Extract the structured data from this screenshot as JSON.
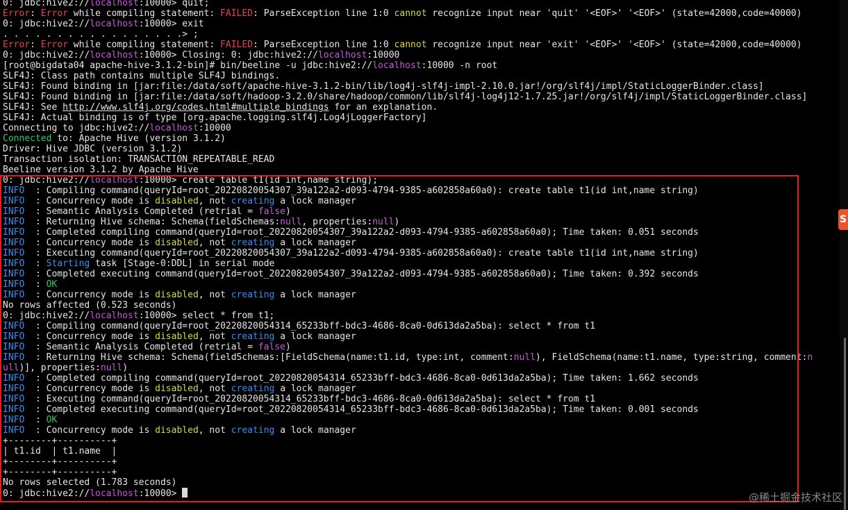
{
  "terminal": {
    "lines": [
      [
        {
          "t": "0: jdbc:hive2://"
        },
        {
          "t": "localhost",
          "c": "magenta"
        },
        {
          "t": ":10000> quit;"
        }
      ],
      [
        {
          "t": "Error",
          "c": "red"
        },
        {
          "t": ": "
        },
        {
          "t": "Error",
          "c": "red"
        },
        {
          "t": " while compiling statement: "
        },
        {
          "t": "FAILED",
          "c": "red"
        },
        {
          "t": ": ParseException line 1:0 "
        },
        {
          "t": "cannot",
          "c": "yellow"
        },
        {
          "t": " recognize input near 'quit' '<EOF>' '<EOF>' (state=42000,code=40000)"
        }
      ],
      [
        {
          "t": "0: jdbc:hive2://"
        },
        {
          "t": "localhost",
          "c": "magenta"
        },
        {
          "t": ":10000> exit"
        }
      ],
      [
        {
          "t": ". . . . . . . . . . . . . . . . .> ;"
        }
      ],
      [
        {
          "t": "Error",
          "c": "red"
        },
        {
          "t": ": "
        },
        {
          "t": "Error",
          "c": "red"
        },
        {
          "t": " while compiling statement: "
        },
        {
          "t": "FAILED",
          "c": "red"
        },
        {
          "t": ": ParseException line 1:0 "
        },
        {
          "t": "cannot",
          "c": "yellow"
        },
        {
          "t": " recognize input near 'exit' '<EOF>' '<EOF>' (state=42000,code=40000)"
        }
      ],
      [
        {
          "t": "0: jdbc:hive2://"
        },
        {
          "t": "localhost",
          "c": "magenta"
        },
        {
          "t": ":10000> Closing: 0: jdbc:hive2://"
        },
        {
          "t": "localhost",
          "c": "magenta"
        },
        {
          "t": ":10000"
        }
      ],
      [
        {
          "t": "[root@bigdata04 apache-hive-3.1.2-bin]# bin/beeline -u jdbc:hive2://"
        },
        {
          "t": "localhost",
          "c": "magenta"
        },
        {
          "t": ":10000 -n root"
        }
      ],
      [
        {
          "t": "SLF4J: Class path contains multiple SLF4J bindings."
        }
      ],
      [
        {
          "t": "SLF4J: Found binding in [jar:file:/data/soft/apache-hive-3.1.2-bin/lib/log4j-slf4j-impl-2.10.0.jar!/org/slf4j/impl/StaticLoggerBinder.class]"
        }
      ],
      [
        {
          "t": "SLF4J: Found binding in [jar:file:/data/soft/hadoop-3.2.0/share/hadoop/common/lib/slf4j-log4j12-1.7.25.jar!/org/slf4j/impl/StaticLoggerBinder.class]"
        }
      ],
      [
        {
          "t": "SLF4J: See "
        },
        {
          "t": "http://www.slf4j.org/codes.html#multiple_bindings",
          "c": "link"
        },
        {
          "t": " for an explanation."
        }
      ],
      [
        {
          "t": "SLF4J: Actual binding is of type [org.apache.logging.slf4j.Log4jLoggerFactory]"
        }
      ],
      [
        {
          "t": "Connecting to jdbc:hive2://"
        },
        {
          "t": "localhost",
          "c": "magenta"
        },
        {
          "t": ":10000"
        }
      ],
      [
        {
          "t": "Connected",
          "c": "green"
        },
        {
          "t": " to: Apache Hive (version 3.1.2)"
        }
      ],
      [
        {
          "t": "Driver: Hive JDBC (version 3.1.2)"
        }
      ],
      [
        {
          "t": "Transaction isolation: TRANSACTION_REPEATABLE_READ"
        }
      ],
      [
        {
          "t": "Beeline version 3.1.2 by Apache Hive"
        }
      ],
      [
        {
          "t": "0: jdbc:hive2://"
        },
        {
          "t": "localhost",
          "c": "magenta"
        },
        {
          "t": ":10000> create table t1(id int,name string);"
        }
      ],
      [
        {
          "t": "INFO ",
          "c": "blue"
        },
        {
          "t": " : Compiling command(queryId=root_20220820054307_39a122a2-d093-4794-9385-a602858a60a0): create table t1(id int,name string)"
        }
      ],
      [
        {
          "t": "INFO ",
          "c": "blue"
        },
        {
          "t": " : Concurrency mode is "
        },
        {
          "t": "disabled",
          "c": "yellow"
        },
        {
          "t": ", not "
        },
        {
          "t": "creating",
          "c": "blue"
        },
        {
          "t": " a lock manager"
        }
      ],
      [
        {
          "t": "INFO ",
          "c": "blue"
        },
        {
          "t": " : Semantic Analysis Completed (retrial = "
        },
        {
          "t": "false",
          "c": "magenta"
        },
        {
          "t": ")"
        }
      ],
      [
        {
          "t": "INFO ",
          "c": "blue"
        },
        {
          "t": " : Returning Hive schema: Schema(fieldSchemas:"
        },
        {
          "t": "null",
          "c": "magenta"
        },
        {
          "t": ", properties:"
        },
        {
          "t": "null",
          "c": "magenta"
        },
        {
          "t": ")"
        }
      ],
      [
        {
          "t": "INFO ",
          "c": "blue"
        },
        {
          "t": " : Completed compiling command(queryId=root_20220820054307_39a122a2-d093-4794-9385-a602858a60a0); Time taken: 0.051 seconds"
        }
      ],
      [
        {
          "t": "INFO ",
          "c": "blue"
        },
        {
          "t": " : Concurrency mode is "
        },
        {
          "t": "disabled",
          "c": "yellow"
        },
        {
          "t": ", not "
        },
        {
          "t": "creating",
          "c": "blue"
        },
        {
          "t": " a lock manager"
        }
      ],
      [
        {
          "t": "INFO ",
          "c": "blue"
        },
        {
          "t": " : Executing command(queryId=root_20220820054307_39a122a2-d093-4794-9385-a602858a60a0): create table t1(id int,name string)"
        }
      ],
      [
        {
          "t": "INFO ",
          "c": "blue"
        },
        {
          "t": " : "
        },
        {
          "t": "Starting",
          "c": "blue"
        },
        {
          "t": " task [Stage-0:DDL] in serial mode"
        }
      ],
      [
        {
          "t": "INFO ",
          "c": "blue"
        },
        {
          "t": " : Completed executing command(queryId=root_20220820054307_39a122a2-d093-4794-9385-a602858a60a0); Time taken: 0.392 seconds"
        }
      ],
      [
        {
          "t": "INFO ",
          "c": "blue"
        },
        {
          "t": " : "
        },
        {
          "t": "OK",
          "c": "green"
        }
      ],
      [
        {
          "t": "INFO ",
          "c": "blue"
        },
        {
          "t": " : Concurrency mode is "
        },
        {
          "t": "disabled",
          "c": "yellow"
        },
        {
          "t": ", not "
        },
        {
          "t": "creating",
          "c": "blue"
        },
        {
          "t": " a lock manager"
        }
      ],
      [
        {
          "t": "No rows affected (0.523 seconds)"
        }
      ],
      [
        {
          "t": "0: jdbc:hive2://"
        },
        {
          "t": "localhost",
          "c": "magenta"
        },
        {
          "t": ":10000> select * from t1;"
        }
      ],
      [
        {
          "t": "INFO ",
          "c": "blue"
        },
        {
          "t": " : Compiling command(queryId=root_20220820054314_65233bff-bdc3-4686-8ca0-0d613da2a5ba): select * from t1"
        }
      ],
      [
        {
          "t": "INFO ",
          "c": "blue"
        },
        {
          "t": " : Concurrency mode is "
        },
        {
          "t": "disabled",
          "c": "yellow"
        },
        {
          "t": ", not "
        },
        {
          "t": "creating",
          "c": "blue"
        },
        {
          "t": " a lock manager"
        }
      ],
      [
        {
          "t": "INFO ",
          "c": "blue"
        },
        {
          "t": " : Semantic Analysis Completed (retrial = "
        },
        {
          "t": "false",
          "c": "magenta"
        },
        {
          "t": ")"
        }
      ],
      [
        {
          "t": "INFO ",
          "c": "blue"
        },
        {
          "t": " : Returning Hive schema: Schema(fieldSchemas:[FieldSchema(name:t1.id, type:int, comment:"
        },
        {
          "t": "null",
          "c": "magenta"
        },
        {
          "t": "), FieldSchema(name:t1.name, type:string, comment:"
        },
        {
          "t": "n",
          "c": "magenta"
        }
      ],
      [
        {
          "t": "ull",
          "c": "magenta"
        },
        {
          "t": ")], properties:"
        },
        {
          "t": "null",
          "c": "magenta"
        },
        {
          "t": ")"
        }
      ],
      [
        {
          "t": "INFO ",
          "c": "blue"
        },
        {
          "t": " : Completed compiling command(queryId=root_20220820054314_65233bff-bdc3-4686-8ca0-0d613da2a5ba); Time taken: 1.662 seconds"
        }
      ],
      [
        {
          "t": "INFO ",
          "c": "blue"
        },
        {
          "t": " : Concurrency mode is "
        },
        {
          "t": "disabled",
          "c": "yellow"
        },
        {
          "t": ", not "
        },
        {
          "t": "creating",
          "c": "blue"
        },
        {
          "t": " a lock manager"
        }
      ],
      [
        {
          "t": "INFO ",
          "c": "blue"
        },
        {
          "t": " : Executing command(queryId=root_20220820054314_65233bff-bdc3-4686-8ca0-0d613da2a5ba): select * from t1"
        }
      ],
      [
        {
          "t": "INFO ",
          "c": "blue"
        },
        {
          "t": " : Completed executing command(queryId=root_20220820054314_65233bff-bdc3-4686-8ca0-0d613da2a5ba); Time taken: 0.001 seconds"
        }
      ],
      [
        {
          "t": "INFO ",
          "c": "blue"
        },
        {
          "t": " : "
        },
        {
          "t": "OK",
          "c": "green"
        }
      ],
      [
        {
          "t": "INFO ",
          "c": "blue"
        },
        {
          "t": " : Concurrency mode is "
        },
        {
          "t": "disabled",
          "c": "yellow"
        },
        {
          "t": ", not "
        },
        {
          "t": "creating",
          "c": "blue"
        },
        {
          "t": " a lock manager"
        }
      ],
      [
        {
          "t": "+--------+----------+"
        }
      ],
      [
        {
          "t": "| t1.id  | t1.name  |"
        }
      ],
      [
        {
          "t": "+--------+----------+"
        }
      ],
      [
        {
          "t": "+--------+----------+"
        }
      ],
      [
        {
          "t": "No rows selected (1.783 seconds)"
        }
      ],
      [
        {
          "t": "0: jdbc:hive2://"
        },
        {
          "t": "localhost",
          "c": "magenta"
        },
        {
          "t": ":10000> "
        },
        {
          "cursor": true
        }
      ]
    ]
  },
  "colors": {
    "background": "#000000",
    "text": "#e6e6e6",
    "error_red": "#e64545",
    "warning_yellow": "#d8d84a",
    "keyword_magenta": "#c65bd8",
    "info_blue": "#3b8ef0",
    "ok_green": "#35c95a",
    "highlight_border": "#e02020"
  },
  "side_badge": {
    "text": "S",
    "icon": "juejin-badge-icon"
  },
  "watermark": {
    "text": "@稀土掘金技术社区"
  }
}
